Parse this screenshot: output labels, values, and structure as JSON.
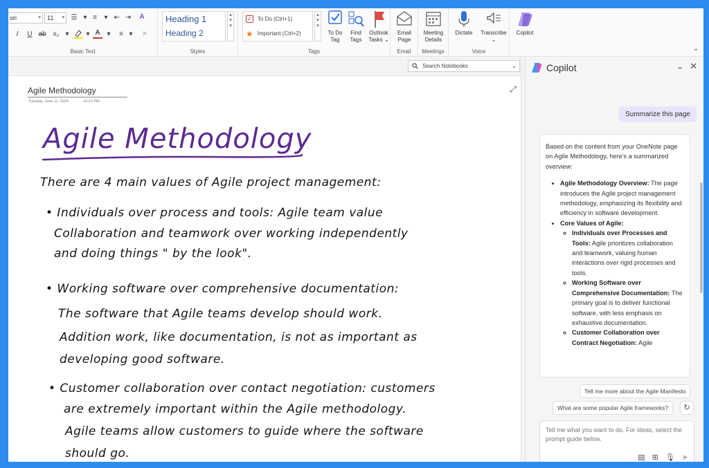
{
  "ribbon": {
    "font_name": "ori",
    "font_size": "11",
    "groups": {
      "basic_text": "Basic Text",
      "styles": "Styles",
      "tags": "Tags",
      "email": "Email",
      "meetings": "Meetings",
      "voice": "Voice"
    },
    "styles": [
      "Heading 1",
      "Heading 2"
    ],
    "tags": [
      {
        "label": "To Do (Ctrl+1)",
        "icon": "checkbox-icon"
      },
      {
        "label": "Important (Ctrl+2)",
        "icon": "star-icon"
      }
    ],
    "buttons": {
      "to_do_tag": [
        "To Do",
        "Tag"
      ],
      "find_tags": [
        "Find",
        "Tags"
      ],
      "outlook_tasks": [
        "Outlook",
        "Tasks ⌄"
      ],
      "email_page": [
        "Email",
        "Page"
      ],
      "meeting_details": [
        "Meeting",
        "Details"
      ],
      "dictate": "Dictate",
      "transcribe": "Transcribe",
      "copilot": "Copilot"
    },
    "colors": {
      "highlight": "#f2e600",
      "font_color": "#c0392b",
      "copilot": "#7b5cd6"
    }
  },
  "page": {
    "search_placeholder": "Search Notebooks",
    "title": "Agile Methodology",
    "date": "Tuesday, June 11, 2024",
    "time": "10:21 PM",
    "ink_title": "Agile Methodology",
    "ink_lines": [
      "There are 4 main values of Agile project management:",
      "• Individuals over process and tools: Agile team value",
      "Collaboration and teamwork over working independently",
      "and doing things \" by the look\".",
      "• Working software over comprehensive documentation:",
      "The software that Agile teams develop should work.",
      "Addition work, like documentation, is not as important as",
      "developing good software.",
      "• Customer collaboration over contact negotiation: customers",
      "are extremely important within the Agile methodology.",
      "Agile teams allow customers to guide where the software",
      "should go."
    ]
  },
  "copilot": {
    "title": "Copilot",
    "user_message": "Summarize this page",
    "response": {
      "intro": "Based on the content from your OneNote page on Agile Methodology, here's a summarized overview:",
      "overview_title": "Agile Methodology Overview:",
      "overview_text": "The page introduces the Agile project management methodology, emphasizing its flexibility and efficiency in software development.",
      "core_title": "Core Values of Agile:",
      "values": [
        {
          "title": "Individuals over Processes and Tools:",
          "text": "Agile prioritizes collaboration and teamwork, valuing human interactions over rigid processes and tools."
        },
        {
          "title": "Working Software over Comprehensive Documentation:",
          "text": "The primary goal is to deliver functional software, with less emphasis on exhaustive documentation."
        },
        {
          "title": "Customer Collaboration over Contract Negotiation:",
          "text": "Agile"
        }
      ]
    },
    "suggestions": [
      "Tell me more about the Agile Manifesto",
      "What are some popular Agile frameworks?"
    ],
    "input_placeholder": "Tell me what you want to do. For ideas, select the prompt guide below."
  }
}
